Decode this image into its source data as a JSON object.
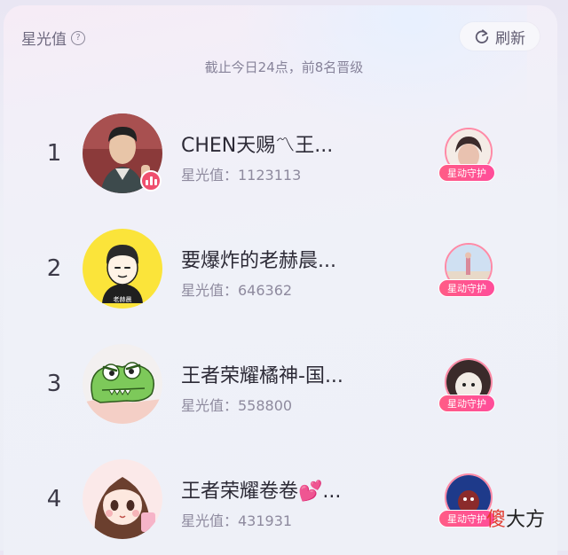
{
  "header": {
    "title": "星光值",
    "help_icon": "?",
    "refresh_label": "刷新",
    "subtitle": "截止今日24点，前8名晋级"
  },
  "rows": [
    {
      "rank": "1",
      "name": "CHEN天赐〽王...",
      "score": "星光值：1123113",
      "guard_label": "星动守护",
      "live": true
    },
    {
      "rank": "2",
      "name": "要爆炸的老赫晨...",
      "score": "星光值：646362",
      "guard_label": "星动守护",
      "live": false,
      "avatar_caption": "老赫晨"
    },
    {
      "rank": "3",
      "name": "王者荣耀橘神-国...",
      "score": "星光值：558800",
      "guard_label": "星动守护",
      "live": false
    },
    {
      "rank": "4",
      "name": "王者荣耀卷卷💕...",
      "score": "星光值：431931",
      "guard_label": "星动守护",
      "live": false
    }
  ],
  "watermark": {
    "first": "傻",
    "rest": "大方"
  },
  "colors": {
    "accent": "#ef4f6e",
    "tag": "#ff5c86",
    "text": "#2c2a36",
    "muted": "#8e8a9e"
  }
}
